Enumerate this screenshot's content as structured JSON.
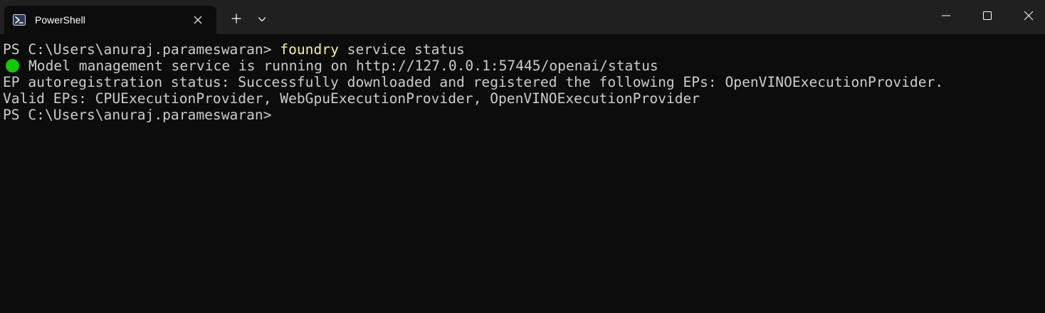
{
  "window": {
    "tab_title": "PowerShell",
    "tab_icon": "powershell-icon",
    "new_tab_icon": "plus-icon",
    "dropdown_icon": "chevron-down-icon",
    "controls": [
      "minimize-icon",
      "maximize-icon",
      "close-icon"
    ]
  },
  "terminal": {
    "line1": {
      "prompt": "PS C:\\Users\\anuraj.parameswaran> ",
      "command": "foundry",
      "args": " service status"
    },
    "line2": {
      "icon": "green-circle-icon",
      "text": "Model management service is running on http://127.0.0.1:57445/openai/status"
    },
    "line3": "EP autoregistration status: Successfully downloaded and registered the following EPs: OpenVINOExecutionProvider.",
    "line4": "Valid EPs: CPUExecutionProvider, WebGpuExecutionProvider, OpenVINOExecutionProvider",
    "line5": "PS C:\\Users\\anuraj.parameswaran>"
  },
  "colors": {
    "background": "#0c0c0c",
    "titlebar": "#202020",
    "text": "#cccccc",
    "command": "#f9f1a5",
    "status_dot": "#16c60c"
  }
}
